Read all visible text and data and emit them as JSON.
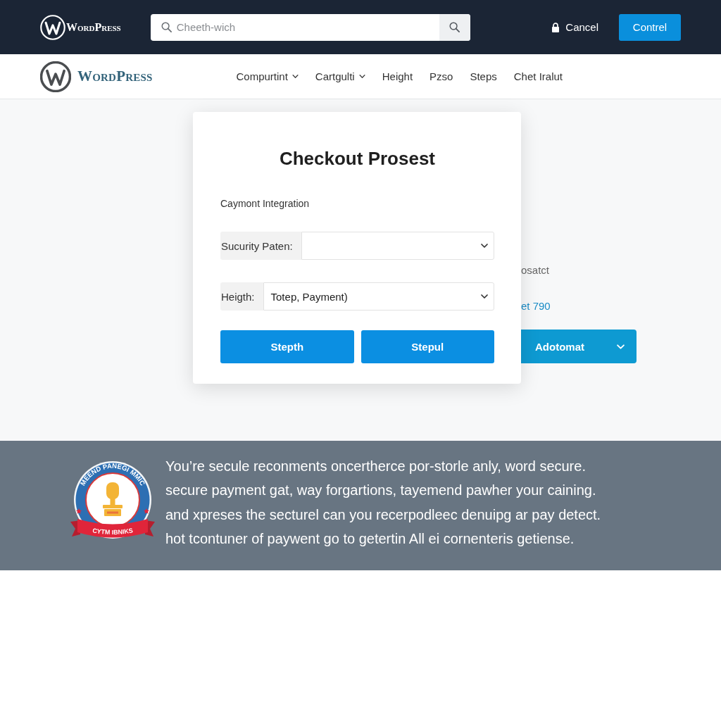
{
  "top_bar": {
    "logo": "WordPress",
    "search": {
      "placeholder": "Cheeth-wich"
    },
    "cancel": "Cancel",
    "button": "Contrel"
  },
  "nav_bar": {
    "logo": "WordPress",
    "items": [
      {
        "label": "Compurtint",
        "kind": "dropdown"
      },
      {
        "label": "Cartgulti",
        "kind": "dropdown"
      },
      {
        "label": "Height",
        "kind": "link"
      },
      {
        "label": "Pzso",
        "kind": "link"
      },
      {
        "label": "Steps",
        "kind": "link"
      },
      {
        "label": "Chet Iralut",
        "kind": "link"
      }
    ]
  },
  "checkout": {
    "title": "Checkout Prosest",
    "subtitle": "Caymont Integration",
    "fields": [
      {
        "label": "Sucurity Paten:"
      },
      {
        "label": "Heigth:",
        "value": "Totep, Payment)"
      }
    ],
    "buttons": [
      "Stepth",
      "Stepul"
    ]
  },
  "side_panel": [
    {
      "kind": "text",
      "text": "osatct"
    },
    {
      "kind": "link",
      "text": "et 790"
    },
    {
      "kind": "split_button",
      "text": "Adotomat"
    }
  ],
  "banner": {
    "badge": {
      "ring_text": "MEEND PANEGI MMIC",
      "ribbon_text": "CYTM IBNIKS"
    },
    "lines": [
      "You’re secule reconments oncertherce por-storle anly, word secure.",
      "secure payment gat, way forgartions, tayemend pawher your caining.",
      "and xpreses the secturel can you recerpodleec denuipg ar pay detect.",
      "hot tcontuner of paywent go to getertin All ei cornenteris getiense."
    ]
  }
}
